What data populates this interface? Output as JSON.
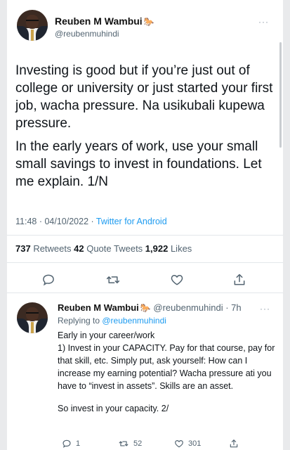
{
  "tweet": {
    "author_name": "Reuben M Wambui",
    "author_emoji": "🐎",
    "author_handle": "@reubenmuhindi",
    "more": "···",
    "paragraph1": "Investing is good but if you’re just out of college or university or just started your first job, wacha pressure. Na usikubali kupewa pressure.",
    "paragraph2": "In the early years of work, use your small small savings to invest in foundations. Let me explain. 1/N",
    "time": "11:48 · 04/10/2022 · ",
    "client": "Twitter for Android",
    "retweets_count": "737",
    "retweets_label": " Retweets  ",
    "quotes_count": "42",
    "quotes_label": " Quote Tweets  ",
    "likes_count": "1,922",
    "likes_label": " Likes",
    "icons": [
      "reply-icon",
      "retweet-icon",
      "like-icon",
      "share-icon"
    ]
  },
  "reply": {
    "author_name": "Reuben M Wambui",
    "author_emoji": "🐎",
    "handle_time": "@reubenmuhindi · 7h",
    "more": "···",
    "replying_prefix": "Replying to ",
    "replying_to": "@reubenmuhindi",
    "line1": "Early in your career/work",
    "line2": "1) Invest in your CAPACITY. Pay for that course, pay for that skill, etc. Simply put, ask yourself: How can I increase my earning potential? Wacha pressure ati you have to “invest in assets”. Skills are an asset.",
    "line3": "So invest in your capacity. 2/",
    "reply_count": "1",
    "retweet_count": "52",
    "like_count": "301"
  },
  "colors": {
    "link": "#1d9bf0",
    "muted": "#536471",
    "text": "#0f1419"
  }
}
